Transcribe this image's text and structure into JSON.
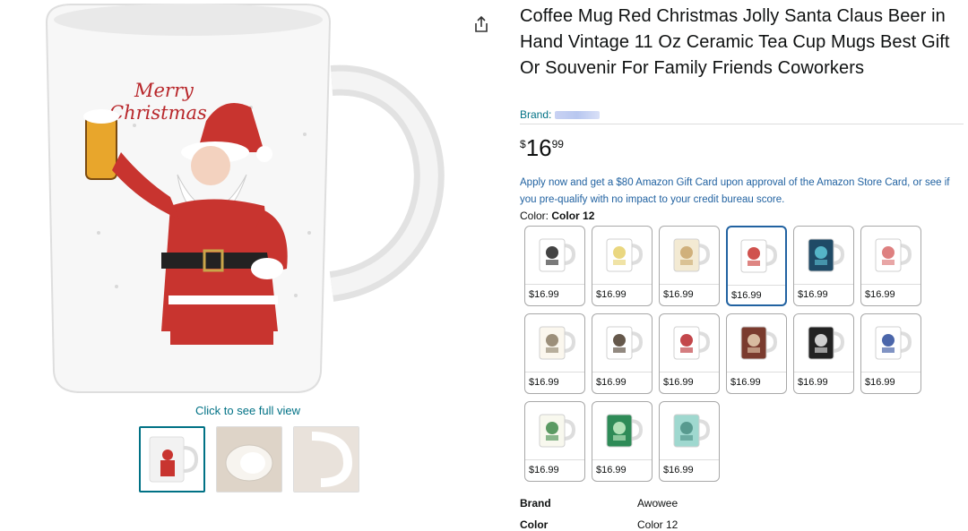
{
  "product": {
    "title": "Coffee Mug Red Christmas Jolly Santa Claus Beer in Hand Vintage 11 Oz Ceramic Tea Cup Mugs Best Gift Or Souvenir For Family Friends Coworkers",
    "brand_label": "Brand:",
    "price_symbol": "$",
    "price_whole": "16",
    "price_fraction": "99",
    "promo_text": "Apply now and get a $80 Amazon Gift Card upon approval of the Amazon Store Card, or see if you pre-qualify with no impact to your credit bureau score.",
    "color_label": "Color:",
    "color_selected": "Color 12"
  },
  "gallery": {
    "caption": "Click to see full view",
    "main_art_text": [
      "Merry",
      "Christmas"
    ]
  },
  "swatches": [
    {
      "price": "$16.99",
      "style": "black-pattern"
    },
    {
      "price": "$16.99",
      "style": "flowers"
    },
    {
      "price": "$16.99",
      "style": "cream-dots"
    },
    {
      "price": "$16.99",
      "style": "santa",
      "selected": true
    },
    {
      "price": "$16.99",
      "style": "aurora"
    },
    {
      "price": "$16.99",
      "style": "snowflake"
    },
    {
      "price": "$16.99",
      "style": "text"
    },
    {
      "price": "$16.99",
      "style": "cat"
    },
    {
      "price": "$16.99",
      "style": "truck"
    },
    {
      "price": "$16.99",
      "style": "brown-pattern"
    },
    {
      "price": "$16.99",
      "style": "black-badge"
    },
    {
      "price": "$16.99",
      "style": "blue-heart"
    },
    {
      "price": "$16.99",
      "style": "confetti"
    },
    {
      "price": "$16.99",
      "style": "green-leaves"
    },
    {
      "price": "$16.99",
      "style": "mint-print"
    }
  ],
  "specs": [
    {
      "key": "Brand",
      "value": "Awowee"
    },
    {
      "key": "Color",
      "value": "Color 12"
    }
  ],
  "colors": {
    "link": "#007185",
    "promo": "#2162a1",
    "selected_border": "#2162a1"
  }
}
